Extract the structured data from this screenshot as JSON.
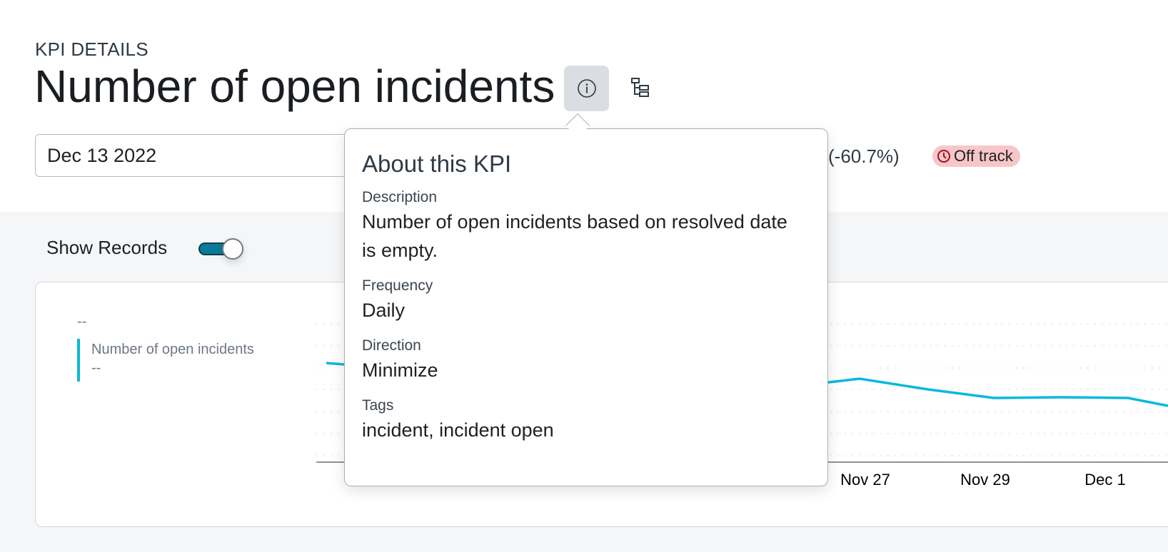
{
  "header": {
    "eyebrow": "KPI DETAILS",
    "title": "Number of open incidents",
    "info_icon": "info-icon",
    "hierarchy_icon": "hierarchy-icon"
  },
  "controls": {
    "date_value": "Dec 13 2022",
    "change": "(-60.7%)",
    "status": {
      "label": "Off track",
      "icon": "clock-icon",
      "color": "#f7c6c8"
    }
  },
  "records": {
    "label": "Show Records",
    "toggle_on": true,
    "accent": "#0a7b98"
  },
  "chart": {
    "legend": {
      "value_top": "--",
      "series_name": "Number of open incidents",
      "series_value": "--",
      "series_color": "#0bb8dc"
    },
    "x_ticks": [
      "Nov 27",
      "Nov 29",
      "Dec 1"
    ]
  },
  "popup": {
    "title": "About this KPI",
    "fields": [
      {
        "label": "Description",
        "value": "Number of open incidents based on resolved date is empty."
      },
      {
        "label": "Frequency",
        "value": "Daily"
      },
      {
        "label": "Direction",
        "value": "Minimize"
      },
      {
        "label": "Tags",
        "value": "incident, incident open"
      }
    ]
  }
}
